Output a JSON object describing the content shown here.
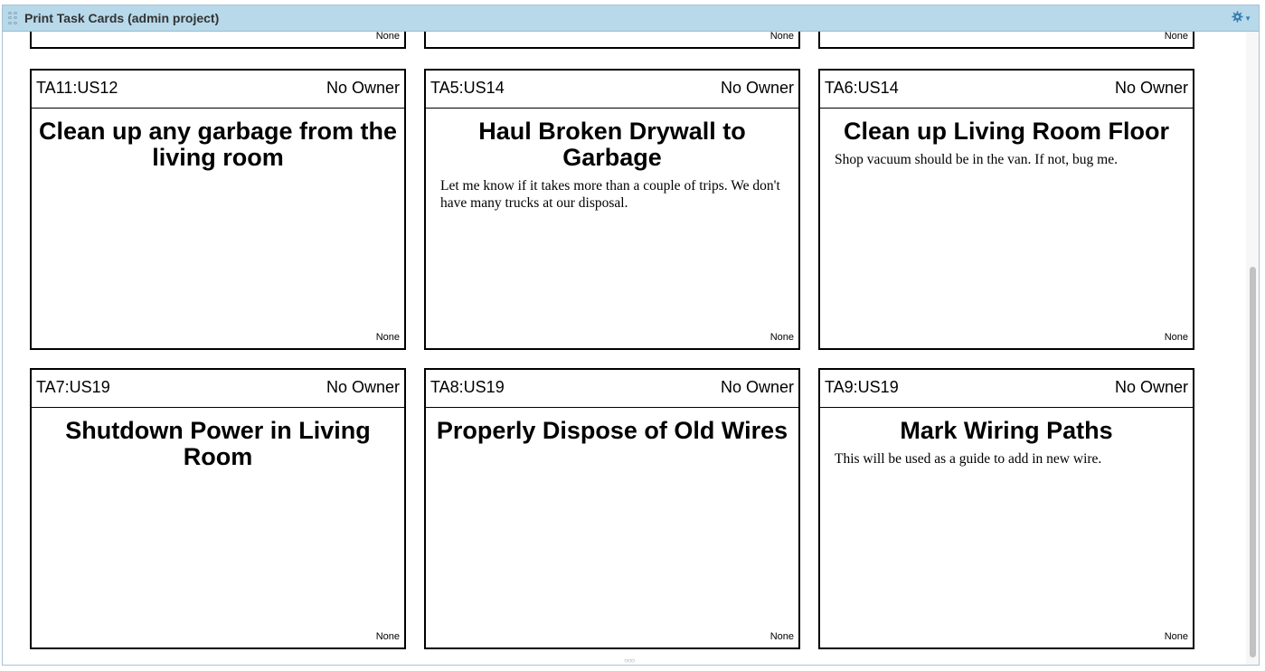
{
  "panel": {
    "title": "Print Task Cards (admin project)"
  },
  "top_row": [
    {
      "estimate": "None"
    },
    {
      "estimate": "None"
    },
    {
      "estimate": "None"
    }
  ],
  "cards": [
    {
      "id": "TA11:US12",
      "owner": "No Owner",
      "name": "Clean up any garbage from the living room",
      "description": "",
      "estimate": "None"
    },
    {
      "id": "TA5:US14",
      "owner": "No Owner",
      "name": "Haul Broken Drywall to Garbage",
      "description": "Let me know if it takes more than a couple of trips. We don't have many trucks at our disposal.",
      "estimate": "None"
    },
    {
      "id": "TA6:US14",
      "owner": "No Owner",
      "name": "Clean up Living Room Floor",
      "description": "Shop vacuum should be in the van. If not, bug me.",
      "estimate": "None"
    },
    {
      "id": "TA7:US19",
      "owner": "No Owner",
      "name": "Shutdown Power in Living Room",
      "description": "",
      "estimate": "None"
    },
    {
      "id": "TA8:US19",
      "owner": "No Owner",
      "name": "Properly Dispose of Old Wires",
      "description": "",
      "estimate": "None"
    },
    {
      "id": "TA9:US19",
      "owner": "No Owner",
      "name": "Mark Wiring Paths",
      "description": "This will be used as a guide to add in new wire.",
      "estimate": "None"
    }
  ],
  "icons": {
    "settings": "gear-icon",
    "drag": "grip-icon"
  }
}
